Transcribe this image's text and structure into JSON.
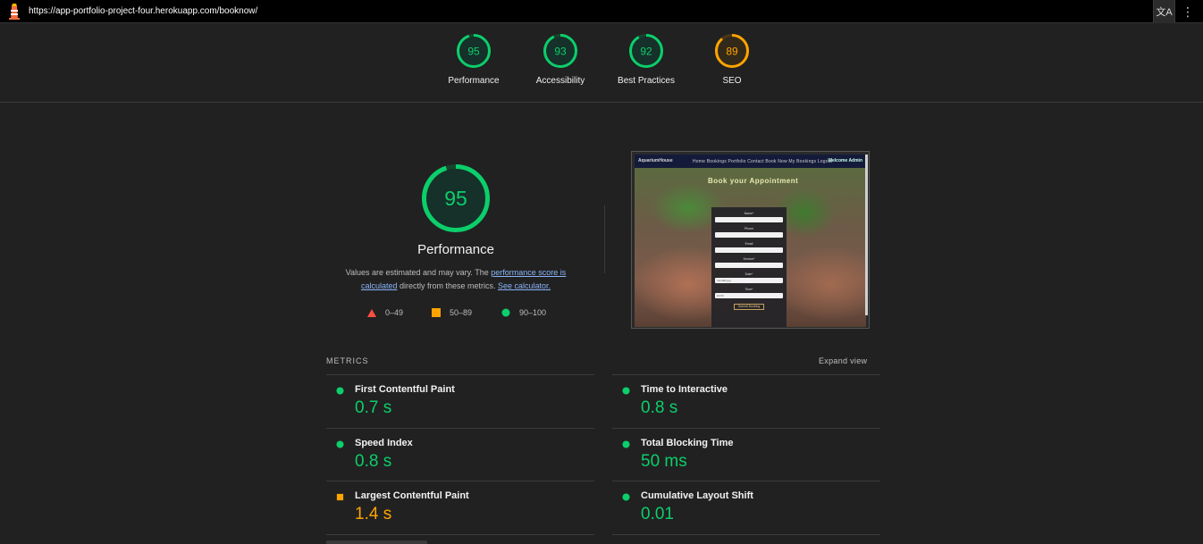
{
  "browser": {
    "url": "https://app-portfolio-project-four.herokuapp.com/booknow/",
    "translate_icon": "translate-icon",
    "menu_icon": "kebab-menu-icon",
    "menu_glyph": "⋮",
    "translate_glyph": "文A"
  },
  "colors": {
    "pass": "#0cce6b",
    "average": "#ffa400",
    "fail": "#ff4e42"
  },
  "summary": [
    {
      "score": "95",
      "label": "Performance",
      "status": "pass"
    },
    {
      "score": "93",
      "label": "Accessibility",
      "status": "pass"
    },
    {
      "score": "92",
      "label": "Best Practices",
      "status": "pass"
    },
    {
      "score": "89",
      "label": "SEO",
      "status": "average"
    }
  ],
  "performance": {
    "score": "95",
    "title": "Performance",
    "desc_prefix": "Values are estimated and may vary. The ",
    "link_score": "performance score is calculated",
    "desc_middle": " directly from these metrics. ",
    "link_calculator": "See calculator."
  },
  "legend": [
    {
      "range": "0–49",
      "shape": "triangle"
    },
    {
      "range": "50–89",
      "shape": "square"
    },
    {
      "range": "90–100",
      "shape": "circle"
    }
  ],
  "thumbnail": {
    "brand": "AquariumHouse",
    "links": "Home   Bookings   Portfolio   Contact   Book Now   My Bookings   Logout",
    "welcome": "Welcome Admin",
    "heading": "Book your Appointment",
    "fields": [
      "Name*",
      "Phone",
      "Email",
      "Service*",
      "Date*",
      "Time*"
    ],
    "date_value": "mm/dd/yyyy",
    "time_value": "10:00",
    "submit": "Submit Booking"
  },
  "metrics": {
    "heading": "METRICS",
    "expand_label": "Expand view",
    "left": [
      {
        "name": "First Contentful Paint",
        "value": "0.7 s",
        "status": "pass"
      },
      {
        "name": "Speed Index",
        "value": "0.8 s",
        "status": "pass"
      },
      {
        "name": "Largest Contentful Paint",
        "value": "1.4 s",
        "status": "average"
      }
    ],
    "right": [
      {
        "name": "Time to Interactive",
        "value": "0.8 s",
        "status": "pass"
      },
      {
        "name": "Total Blocking Time",
        "value": "50 ms",
        "status": "pass"
      },
      {
        "name": "Cumulative Layout Shift",
        "value": "0.01",
        "status": "pass"
      }
    ]
  }
}
